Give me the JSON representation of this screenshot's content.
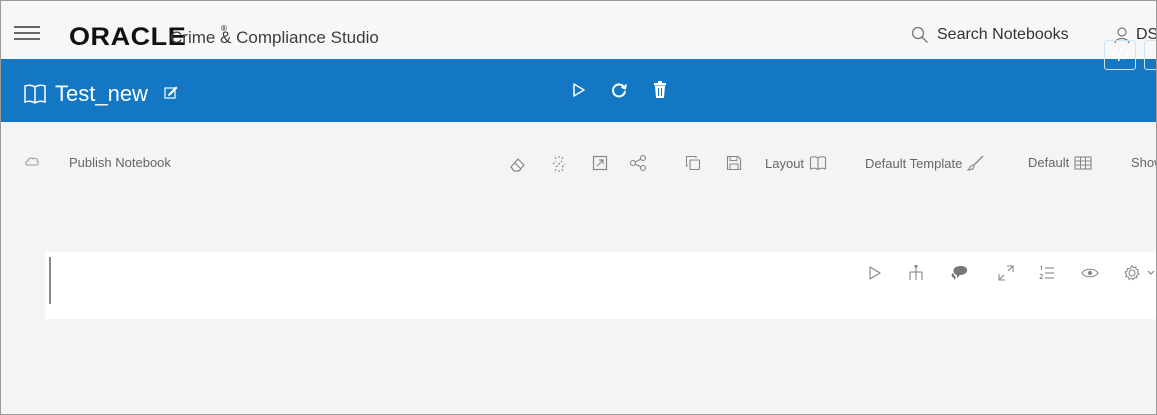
{
  "header": {
    "logo_text": "ORACLE",
    "logo_reg": "®",
    "app_name": "Crime & Compliance Studio",
    "search_label": "Search Notebooks",
    "user_label": "DS"
  },
  "notebook": {
    "title": "Test_new"
  },
  "toolbar": {
    "publish_label": "Publish Notebook",
    "layout_label": "Layout",
    "template_label": "Default Template",
    "default_label": "Default",
    "show_label": "Show"
  },
  "colors": {
    "brand_blue": "#1377c4",
    "page_bg": "#f4f4f4"
  }
}
